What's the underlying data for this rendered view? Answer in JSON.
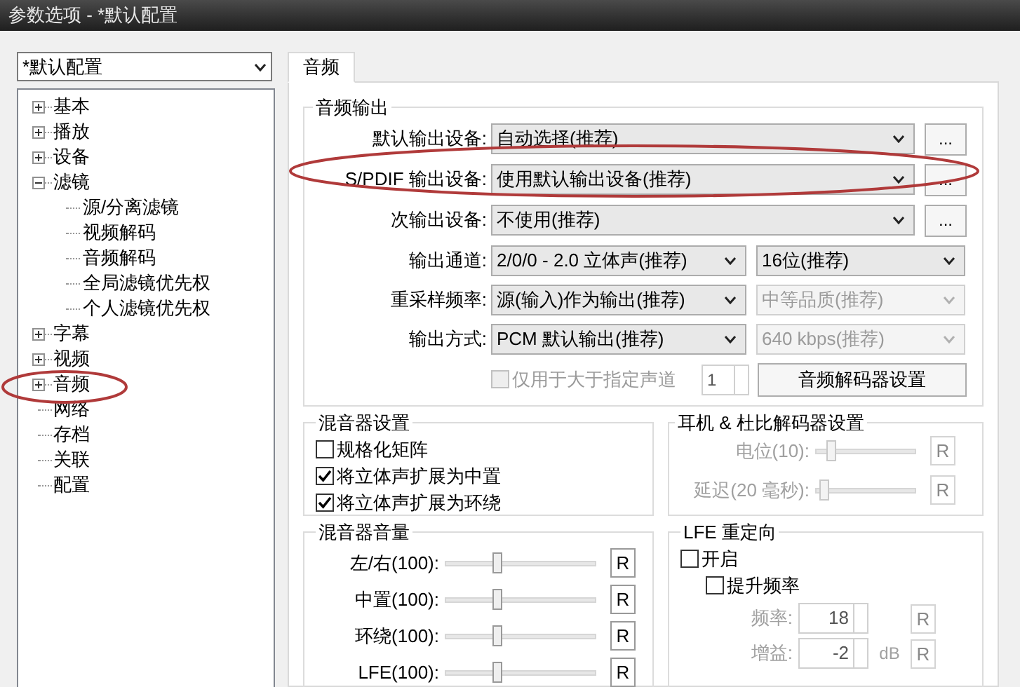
{
  "window": {
    "title": "参数选项 - *默认配置"
  },
  "profile_select": {
    "value": "*默认配置"
  },
  "tree": [
    {
      "label": "基本",
      "expanded": false
    },
    {
      "label": "播放",
      "expanded": false
    },
    {
      "label": "设备",
      "expanded": false
    },
    {
      "label": "滤镜",
      "expanded": true,
      "children": [
        {
          "label": "源/分离滤镜"
        },
        {
          "label": "视频解码"
        },
        {
          "label": "音频解码"
        },
        {
          "label": "全局滤镜优先权"
        },
        {
          "label": "个人滤镜优先权"
        }
      ]
    },
    {
      "label": "字幕",
      "expanded": false
    },
    {
      "label": "视频",
      "expanded": false
    },
    {
      "label": "音频",
      "expanded": false
    },
    {
      "label": "网络"
    },
    {
      "label": "存档"
    },
    {
      "label": "关联"
    },
    {
      "label": "配置"
    }
  ],
  "tabs": [
    {
      "label": "音频",
      "selected": true
    }
  ],
  "audio_output": {
    "title": "音频输出",
    "rows": [
      {
        "kind": "device",
        "label": "默认输出设备:",
        "value": "自动选择(推荐)",
        "button": "..."
      },
      {
        "kind": "device",
        "label": "S/PDIF 输出设备:",
        "value": "使用默认输出设备(推荐)",
        "button": "..."
      },
      {
        "kind": "device",
        "label": "次输出设备:",
        "value": "不使用(推荐)",
        "button": "..."
      },
      {
        "kind": "pair",
        "label": "输出通道:",
        "value": "2/0/0 - 2.0 立体声(推荐)",
        "value_2": "16位(推荐)",
        "disabled_2": false
      },
      {
        "kind": "pair",
        "label": "重采样频率:",
        "value": "源(输入)作为输出(推荐)",
        "value_2": "中等品质(推荐)",
        "disabled_2": true
      },
      {
        "kind": "pair",
        "label": "输出方式:",
        "value": "PCM 默认输出(推荐)",
        "value_2": "640 kbps(推荐)",
        "disabled_2": true
      }
    ],
    "channel_limit": {
      "label": "仅用于大于指定声道",
      "checked": false,
      "disabled": true,
      "value": "1"
    },
    "decoder_button": "音频解码器设置"
  },
  "mixer_settings": {
    "title": "混音器设置",
    "checkboxes": [
      {
        "label": "规格化矩阵",
        "checked": false
      },
      {
        "label": "将立体声扩展为中置",
        "checked": true
      },
      {
        "label": "将立体声扩展为环绕",
        "checked": true
      }
    ]
  },
  "headphone": {
    "title": "耳机 & 杜比解码器设置",
    "sliders": [
      {
        "label": "电位(10):",
        "level": 0.12,
        "disabled": true,
        "reset": "R"
      },
      {
        "label": "延迟(20 毫秒):",
        "level": 0.05,
        "disabled": true,
        "reset": "R"
      }
    ]
  },
  "mixer_volume": {
    "title": "混音器音量",
    "sliders": [
      {
        "label": "左/右(100):",
        "level": 0.34,
        "disabled": false,
        "reset": "R"
      },
      {
        "label": "中置(100):",
        "level": 0.34,
        "disabled": false,
        "reset": "R"
      },
      {
        "label": "环绕(100):",
        "level": 0.34,
        "disabled": false,
        "reset": "R"
      },
      {
        "label": "LFE(100):",
        "level": 0.34,
        "disabled": false,
        "reset": "R"
      }
    ]
  },
  "lfe": {
    "title": "LFE 重定向",
    "checkboxes": [
      {
        "label": "开启",
        "checked": false,
        "indent": false
      },
      {
        "label": "提升频率",
        "checked": false,
        "indent": true
      }
    ],
    "fields": [
      {
        "label": "频率:",
        "value": "18",
        "reset": "R"
      },
      {
        "label": "增益:",
        "value": "-2",
        "unit": "dB",
        "reset": "R"
      }
    ]
  }
}
